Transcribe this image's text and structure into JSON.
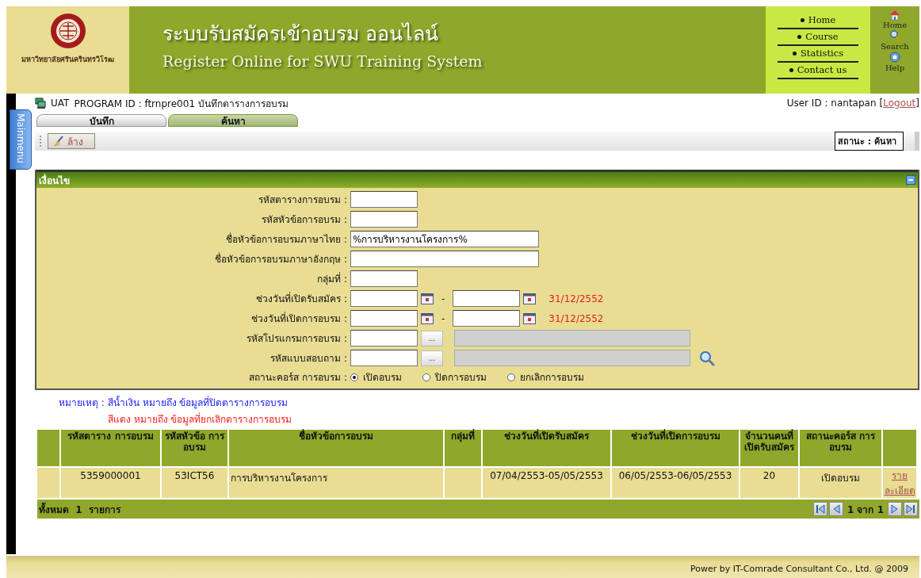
{
  "header": {
    "logo_caption": "มหาวิทยาลัยศรีนครินทรวิโรฒ",
    "title_thai": "ระบบรับสมัครเข้าอบรม ออนไลน์",
    "title_english": "Register Online for  SWU Training System",
    "nav_links": [
      "Home",
      "Course",
      "Statistics",
      "Contact us"
    ],
    "quick_links": [
      {
        "kind": "home",
        "label": "Home"
      },
      {
        "kind": "search",
        "label": "Search"
      },
      {
        "kind": "help",
        "label": "Help"
      }
    ]
  },
  "program_bar": {
    "environment": "UAT",
    "program": "PROGRAM ID : ftrnpre001 บันทึกตารางการอบรม",
    "user": "User ID : nantapan",
    "logout_open": "[",
    "logout": "Logout",
    "logout_close": "]"
  },
  "side_tab": "Mainmenu",
  "tabs": [
    {
      "label": "บันทึก",
      "selected": false
    },
    {
      "label": "ค้นหา",
      "selected": true
    }
  ],
  "toolbar": {
    "clear_button": "ล้าง",
    "status": "สถานะ : ค้นหา"
  },
  "criteria": {
    "title": "เงื่อนไข",
    "fields": [
      {
        "kind": "short",
        "label": "รหัสตารางการอบรม :"
      },
      {
        "kind": "short",
        "label": "รหัสหัวข้อการอบรม :"
      },
      {
        "kind": "long",
        "label": "ชื่อหัวข้อการอบรมภาษาไทย :",
        "value": "%การบริหารงานโครงการ%"
      },
      {
        "kind": "long",
        "label": "ชื่อหัวข้อการอบรมภาษาอังกฤษ :"
      },
      {
        "kind": "short",
        "label": "กลุ่มที่ :"
      },
      {
        "kind": "date-range",
        "label": "ช่วงวันที่เปิดรับสมัคร :",
        "separator": "-",
        "note": "31/12/2552"
      },
      {
        "kind": "date-range",
        "label": "ช่วงวันที่เปิดการอบรม :",
        "separator": "-",
        "note": "31/12/2552"
      },
      {
        "kind": "lookup",
        "label": "รหัสโปรแกรมการอบรม :",
        "button": "..."
      },
      {
        "kind": "lookup-search",
        "label": "รหัสแบบสอบถาม :",
        "button": "..."
      },
      {
        "kind": "radio",
        "label": "สถานะคอร์ส การอบรม :",
        "options": [
          {
            "label": "เปิดอบรม",
            "selected": true
          },
          {
            "label": "ปิดการอบรม",
            "selected": false
          },
          {
            "label": "ยกเลิกการอบรม",
            "selected": false
          }
        ]
      }
    ]
  },
  "legend": {
    "label": "หมายเหตุ :",
    "items": [
      {
        "text": "สีน้ำเงิน หมายถึง ข้อมูลที่ปิดตารางการอบรม",
        "color": "#1a1aff"
      },
      {
        "text": "สีแดง หมายถึง ข้อมูลที่ยกเลิกตารางการอบรม",
        "color": "#ff1a1a"
      }
    ]
  },
  "table": {
    "columns": [
      "รหัสตาราง การอบรม",
      "รหัสหัวข้อ การอบรม",
      "ชื่อหัวข้อการอบรม",
      "กลุ่มที่",
      "ช่วงวันที่เปิดรับสมัคร",
      "ช่วงวันที่เปิดการอบรม",
      "จำนวนคนที่เปิดรับสมัคร",
      "สถานะคอร์ส การอบรม"
    ],
    "rows": [
      {
        "cells": [
          {
            "text": "5359000001"
          },
          {
            "text": "53ICT56"
          },
          {
            "text": "การบริหารงานโครงการ"
          },
          {},
          {
            "text": "07/04/2553-05/05/2553"
          },
          {
            "text": "06/05/2553-06/05/2553"
          },
          {
            "text": "20"
          },
          {
            "text": "เปิดอบรม"
          }
        ],
        "link": "รายละเอียด"
      }
    ],
    "total": "ทั้งหมด  1  รายการ",
    "page_info": "1 จาก 1"
  },
  "footer": "Power by IT-Comrade Consultant Co., Ltd. @ 2009"
}
